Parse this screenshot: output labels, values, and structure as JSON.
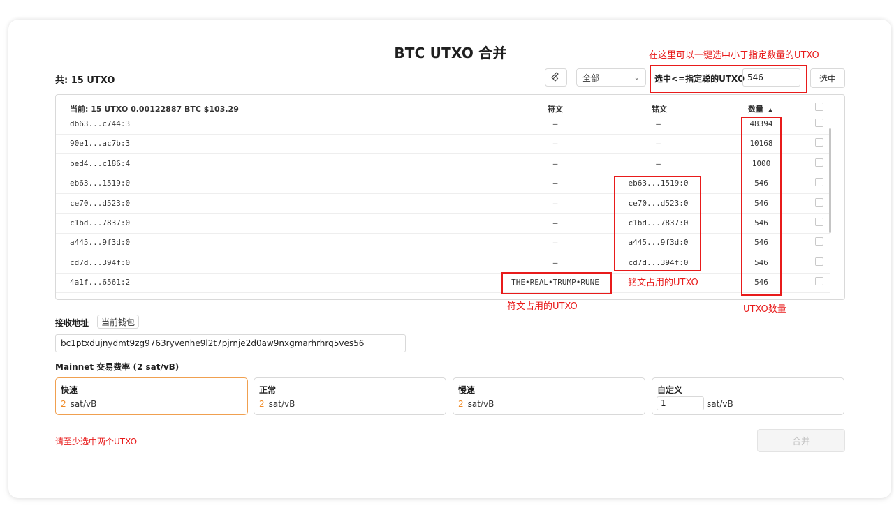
{
  "title": "BTC UTXO 合并",
  "total_label": "共: 15 UTXO",
  "toolbar": {
    "icon": "broom-icon",
    "filter_select": "全部",
    "select_le_label": "选中<=指定聪的UTXO",
    "select_le_value": "546",
    "select_button": "选中"
  },
  "annotations": {
    "top": "在这里可以一键选中小于指定数量的UTXO",
    "runes": "符文占用的UTXO",
    "inscription": "铭文占用的UTXO",
    "amount": "UTXO数量"
  },
  "table": {
    "current_summary": "当前: 15 UTXO 0.00122887 BTC $103.29",
    "col_rune": "符文",
    "col_inscription": "铭文",
    "col_amount": "数量",
    "sort_icon": "sort-up-icon",
    "rows": [
      {
        "utxo": "db63...c744:3",
        "rune": "—",
        "inscription": "—",
        "amount": "48394"
      },
      {
        "utxo": "90e1...ac7b:3",
        "rune": "—",
        "inscription": "—",
        "amount": "10168"
      },
      {
        "utxo": "bed4...c186:4",
        "rune": "—",
        "inscription": "—",
        "amount": "1000"
      },
      {
        "utxo": "eb63...1519:0",
        "rune": "—",
        "inscription": "eb63...1519:0",
        "amount": "546"
      },
      {
        "utxo": "ce70...d523:0",
        "rune": "—",
        "inscription": "ce70...d523:0",
        "amount": "546"
      },
      {
        "utxo": "c1bd...7837:0",
        "rune": "—",
        "inscription": "c1bd...7837:0",
        "amount": "546"
      },
      {
        "utxo": "a445...9f3d:0",
        "rune": "—",
        "inscription": "a445...9f3d:0",
        "amount": "546"
      },
      {
        "utxo": "cd7d...394f:0",
        "rune": "—",
        "inscription": "cd7d...394f:0",
        "amount": "546"
      },
      {
        "utxo": "4a1f...6561:2",
        "rune": "THE•REAL•TRUMP•RUNE",
        "inscription": "",
        "amount": "546"
      }
    ]
  },
  "receive": {
    "label": "接收地址",
    "wallet_button": "当前钱包",
    "address": "bc1ptxdujnydmt9zg9763ryvenhe9l2t7pjrnje2d0aw9nxgmarhrhrq5ves56"
  },
  "fee": {
    "label": "Mainnet 交易费率 (2 sat/vB)",
    "options": [
      {
        "name": "快速",
        "value": "2",
        "unit": "sat/vB"
      },
      {
        "name": "正常",
        "value": "2",
        "unit": "sat/vB"
      },
      {
        "name": "慢速",
        "value": "2",
        "unit": "sat/vB"
      }
    ],
    "custom": {
      "name": "自定义",
      "value": "1",
      "unit": "sat/vB"
    }
  },
  "error_text": "请至少选中两个UTXO",
  "merge_button": "合并",
  "colors": {
    "accent": "#f08a24",
    "annotation": "#e81b1b",
    "error": "#e81b1b"
  }
}
